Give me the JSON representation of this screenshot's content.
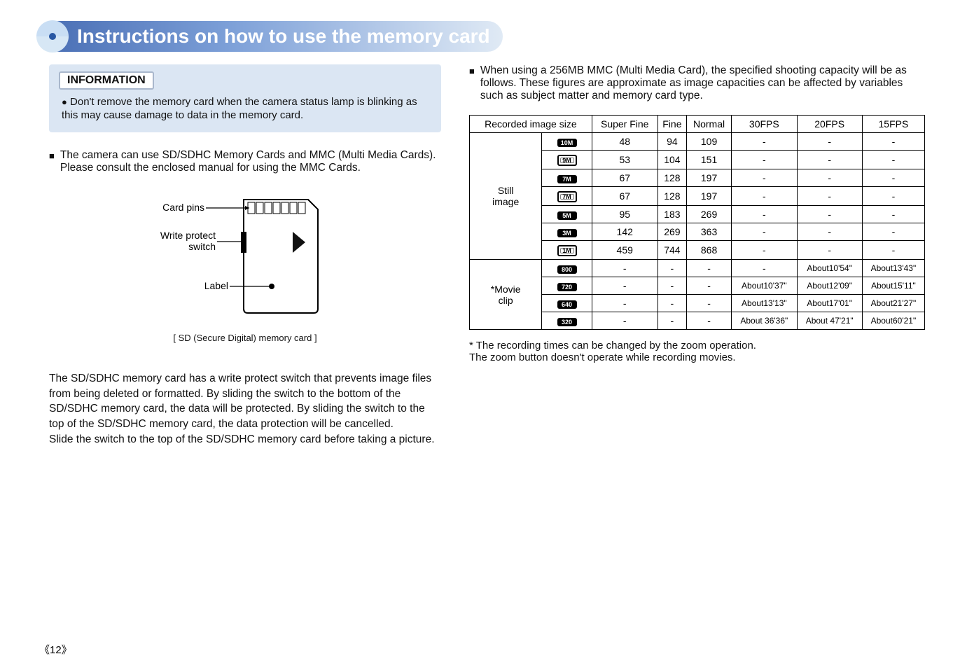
{
  "title": "Instructions on how to use the memory card",
  "information": {
    "heading": "INFORMATION",
    "bullet": "Don't remove the memory card when the camera status lamp is blinking as this may cause damage to data in the memory card."
  },
  "left_bullet": "The camera can use SD/SDHC Memory Cards and MMC (Multi Media Cards). Please consult the enclosed manual for using the MMC Cards.",
  "diagram": {
    "pins": "Card pins",
    "write_protect": "Write protect switch",
    "label": "Label",
    "caption": "[ SD (Secure Digital) memory card ]"
  },
  "left_para": "The SD/SDHC  memory card has a write protect switch that prevents image files from being deleted or formatted. By sliding the switch to the bottom of the SD/SDHC  memory card, the data will be protected. By sliding the switch to the top of the SD/SDHC  memory card, the data protection will be cancelled.\nSlide the switch to the top of the SD/SDHC  memory card before taking a picture.",
  "right_bullet": "When using a 256MB MMC (Multi Media Card), the specified shooting capacity will be as follows. These figures are approximate as image capacities can be affected by variables such as subject matter and memory card type.",
  "table": {
    "headers": {
      "recorded": "Recorded image size",
      "superfine": "Super Fine",
      "fine": "Fine",
      "normal": "Normal",
      "fps30": "30FPS",
      "fps20": "20FPS",
      "fps15": "15FPS"
    },
    "still_label": "Still image",
    "movie_label": "*Movie clip",
    "still_rows": [
      {
        "iconText": "10M",
        "iconStyle": "solid",
        "sf": "48",
        "fine": "94",
        "normal": "109",
        "f30": "-",
        "f20": "-",
        "f15": "-"
      },
      {
        "iconText": "9M",
        "iconStyle": "outline",
        "sf": "53",
        "fine": "104",
        "normal": "151",
        "f30": "-",
        "f20": "-",
        "f15": "-"
      },
      {
        "iconText": "7M",
        "iconStyle": "solid",
        "sf": "67",
        "fine": "128",
        "normal": "197",
        "f30": "-",
        "f20": "-",
        "f15": "-"
      },
      {
        "iconText": "7M",
        "iconStyle": "outline",
        "sf": "67",
        "fine": "128",
        "normal": "197",
        "f30": "-",
        "f20": "-",
        "f15": "-"
      },
      {
        "iconText": "5M",
        "iconStyle": "solid",
        "sf": "95",
        "fine": "183",
        "normal": "269",
        "f30": "-",
        "f20": "-",
        "f15": "-"
      },
      {
        "iconText": "3M",
        "iconStyle": "solid",
        "sf": "142",
        "fine": "269",
        "normal": "363",
        "f30": "-",
        "f20": "-",
        "f15": "-"
      },
      {
        "iconText": "1M",
        "iconStyle": "outline",
        "sf": "459",
        "fine": "744",
        "normal": "868",
        "f30": "-",
        "f20": "-",
        "f15": "-"
      }
    ],
    "movie_rows": [
      {
        "iconText": "800",
        "sf": "-",
        "fine": "-",
        "normal": "-",
        "f30": "-",
        "f20": "About10'54\"",
        "f15": "About13'43\""
      },
      {
        "iconText": "720",
        "sf": "-",
        "fine": "-",
        "normal": "-",
        "f30": "About10'37\"",
        "f20": "About12'09\"",
        "f15": "About15'11\""
      },
      {
        "iconText": "640",
        "sf": "-",
        "fine": "-",
        "normal": "-",
        "f30": "About13'13\"",
        "f20": "About17'01\"",
        "f15": "About21'27\""
      },
      {
        "iconText": "320",
        "sf": "-",
        "fine": "-",
        "normal": "-",
        "f30": "About 36'36\"",
        "f20": "About 47'21\"",
        "f15": "About60'21\""
      }
    ]
  },
  "footnote": "* The recording times can be changed by the zoom operation.\n  The zoom button doesn't operate while recording movies.",
  "page_number": "12"
}
